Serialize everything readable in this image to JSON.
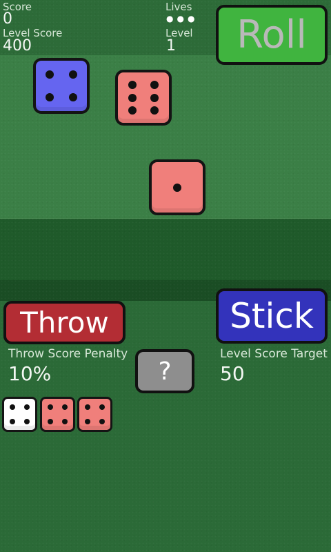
{
  "stats": {
    "score_label": "Score",
    "score_value": "0",
    "level_score_label": "Level Score",
    "level_score_value": "400",
    "lives_label": "Lives",
    "lives_value": "●●●",
    "level_label": "Level",
    "level_value": "1"
  },
  "buttons": {
    "roll": "Roll",
    "stick": "Stick",
    "throw": "Throw",
    "help": "?"
  },
  "throw_penalty": {
    "label": "Throw Score Penalty",
    "value": "10%"
  },
  "level_target": {
    "label": "Level Score Target",
    "value": "50"
  },
  "rolled_dice": [
    {
      "face": 4,
      "color": "blue"
    },
    {
      "face": 6,
      "color": "red"
    },
    {
      "face": 1,
      "color": "red"
    }
  ],
  "kept_dice": [
    {
      "face": 4,
      "color": "white"
    },
    {
      "face": 4,
      "color": "red"
    },
    {
      "face": 4,
      "color": "red"
    }
  ],
  "colors": {
    "table_green": "#2b6a37",
    "play_area_green": "#3b7f46",
    "roll_button": "#40b43f",
    "stick_button": "#3333bb",
    "throw_button": "#b32d34",
    "help_button": "#8e8e8e",
    "die_blue": "#6565f0",
    "die_red": "#f07f7b",
    "die_white": "#ffffff"
  }
}
